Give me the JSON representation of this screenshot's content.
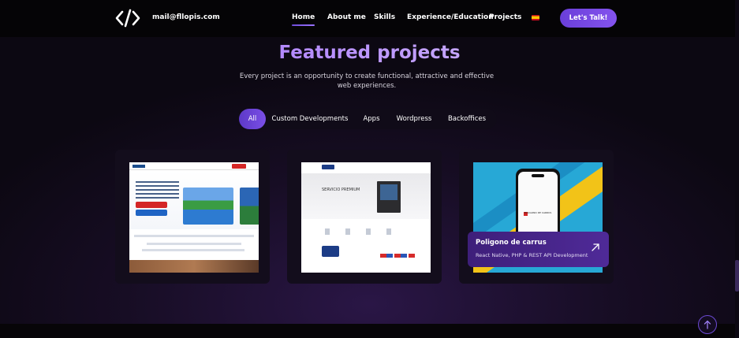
{
  "navbar": {
    "email": "mail@fllopis.com",
    "links": [
      "Home",
      "About me",
      "Skills",
      "Experience/Education",
      "Projects"
    ],
    "active_link": "Home",
    "cta_label": "Let's Talk!"
  },
  "section": {
    "title": "Featured projects",
    "subtitle": "Every project is an opportunity to create functional, attractive and effective web experiences."
  },
  "filters": {
    "items": [
      "All",
      "Custom Developments",
      "Apps",
      "Wordpress",
      "Backoffices"
    ],
    "active": "All"
  },
  "projects": [
    {
      "thumb_text": []
    },
    {
      "thumb_text": [
        "SERVICIO PREMIUM"
      ]
    },
    {
      "title": "Poligono de carrus",
      "tech": "React Native, PHP & REST API Development",
      "thumb_text": [
        "POLIGONO DE CARRUS"
      ]
    }
  ],
  "colors": {
    "accent": "#7a4fe6",
    "background": "#170d24",
    "navbar": "#050406"
  },
  "icons": {
    "logo": "code-brackets-icon",
    "flag": "spain-flag-icon",
    "project_link": "arrow-up-right-icon",
    "back_to_top": "arrow-up-icon"
  }
}
